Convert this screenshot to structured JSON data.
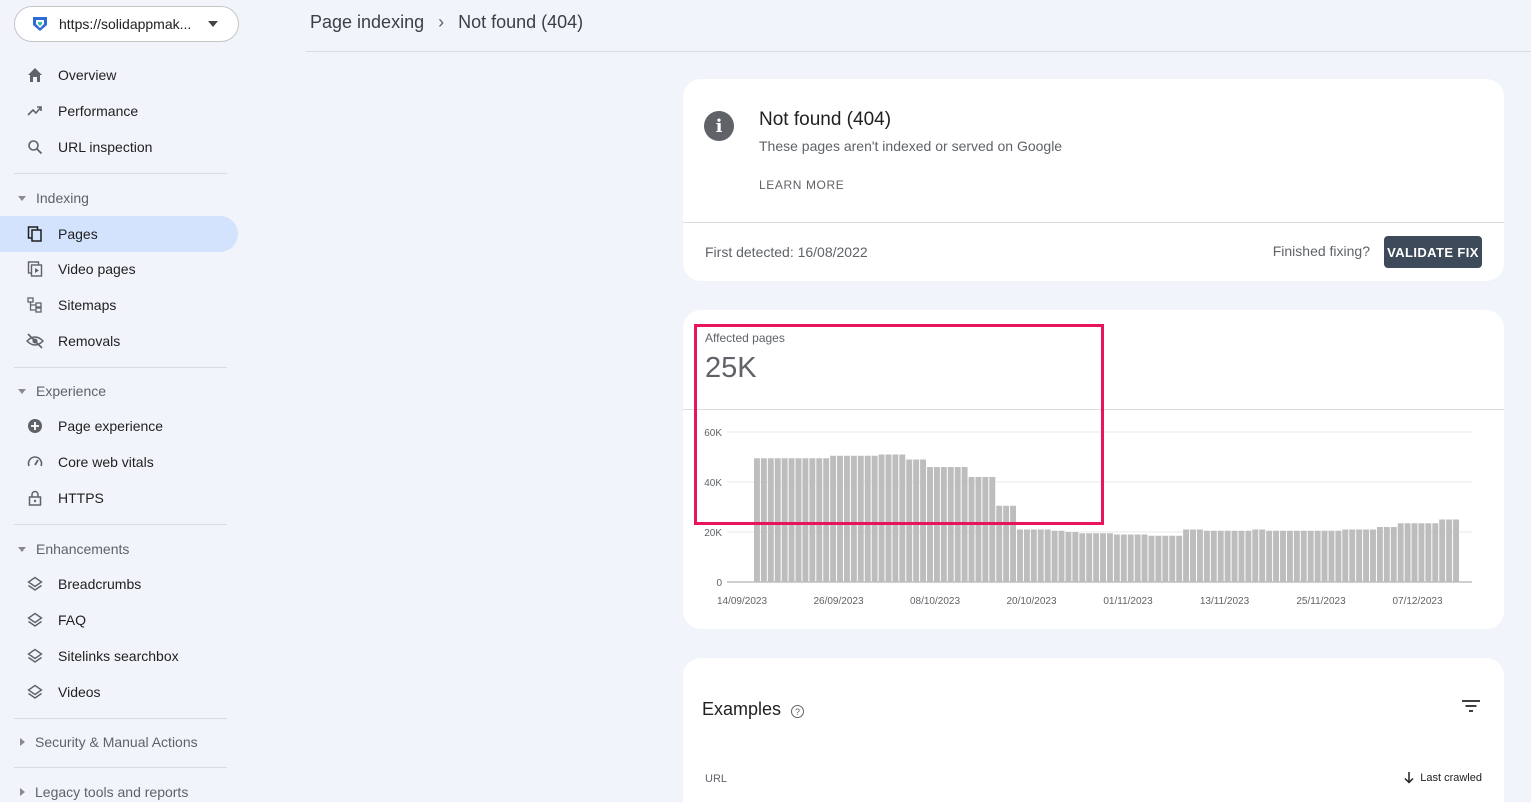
{
  "property": {
    "url": "https://solidappmak..."
  },
  "sidebar": {
    "overview": "Overview",
    "performance": "Performance",
    "url_inspection": "URL inspection",
    "indexing_head": "Indexing",
    "pages": "Pages",
    "video_pages": "Video pages",
    "sitemaps": "Sitemaps",
    "removals": "Removals",
    "experience_head": "Experience",
    "page_experience": "Page experience",
    "core_web_vitals": "Core web vitals",
    "https": "HTTPS",
    "enhancements_head": "Enhancements",
    "breadcrumbs": "Breadcrumbs",
    "faq": "FAQ",
    "sitelinks_searchbox": "Sitelinks searchbox",
    "videos": "Videos",
    "security_head": "Security & Manual Actions",
    "legacy_head": "Legacy tools and reports"
  },
  "breadcrumb": {
    "parent": "Page indexing",
    "current": "Not found (404)"
  },
  "issue": {
    "title": "Not found (404)",
    "subtitle": "These pages aren't indexed or served on Google",
    "learn_more": "LEARN MORE",
    "first_detected": "First detected: 16/08/2022",
    "finished_fixing": "Finished fixing?",
    "validate_fix": "VALIDATE FIX"
  },
  "affected": {
    "label": "Affected pages",
    "value": "25K"
  },
  "chart_data": {
    "type": "bar",
    "ylim": [
      0,
      60000
    ],
    "y_ticks": [
      "0",
      "20K",
      "40K",
      "60K"
    ],
    "x_tick_labels": [
      "14/09/2023",
      "26/09/2023",
      "08/10/2023",
      "20/10/2023",
      "01/11/2023",
      "13/11/2023",
      "25/11/2023",
      "07/12/2023"
    ],
    "bar_color": "#bdbdbd",
    "values": [
      49500,
      49500,
      49500,
      49500,
      49500,
      49500,
      49500,
      49500,
      49500,
      49500,
      49500,
      50500,
      50500,
      50500,
      50500,
      50500,
      50500,
      50500,
      51000,
      51000,
      51000,
      51000,
      49000,
      49000,
      49000,
      46000,
      46000,
      46000,
      46000,
      46000,
      46000,
      42000,
      42000,
      42000,
      42000,
      30500,
      30500,
      30500,
      21000,
      21000,
      21000,
      21000,
      21000,
      20500,
      20500,
      20000,
      20000,
      19500,
      19500,
      19500,
      19500,
      19500,
      19000,
      19000,
      19000,
      19000,
      19000,
      18500,
      18500,
      18500,
      18500,
      18500,
      21000,
      21000,
      21000,
      20500,
      20500,
      20500,
      20500,
      20500,
      20500,
      20500,
      21000,
      21000,
      20500,
      20500,
      20500,
      20500,
      20500,
      20500,
      20500,
      20500,
      20500,
      20500,
      20500,
      21000,
      21000,
      21000,
      21000,
      21000,
      22000,
      22000,
      22000,
      23500,
      23500,
      23500,
      23500,
      23500,
      23500,
      25000,
      25000,
      25000
    ]
  },
  "examples": {
    "title": "Examples",
    "col_url": "URL",
    "col_last_crawled": "Last crawled"
  },
  "colors": {
    "accent_active": "#d3e3fd",
    "highlight": "#e8155d",
    "button": "#3c4a5a"
  }
}
